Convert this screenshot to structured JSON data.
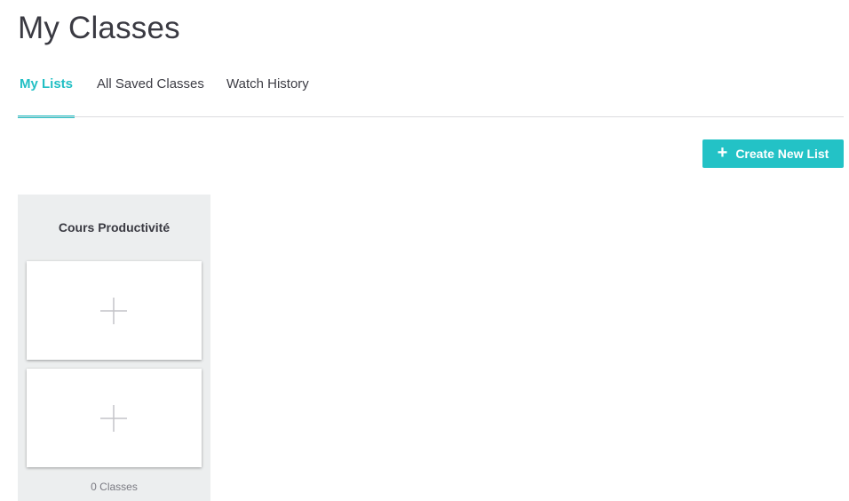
{
  "page": {
    "title": "My Classes"
  },
  "tabs": [
    {
      "label": "My Lists",
      "active": true
    },
    {
      "label": "All Saved Classes",
      "active": false
    },
    {
      "label": "Watch History",
      "active": false
    }
  ],
  "toolbar": {
    "create_label": "Create New List",
    "create_icon": "plus-icon"
  },
  "lists": [
    {
      "title": "Cours Productivité",
      "count_label": "0 Classes",
      "placeholder_icon": "add-icon"
    }
  ],
  "colors": {
    "accent": "#23c2c6",
    "card_background": "#eceeef",
    "divider": "#dcdcdf"
  }
}
